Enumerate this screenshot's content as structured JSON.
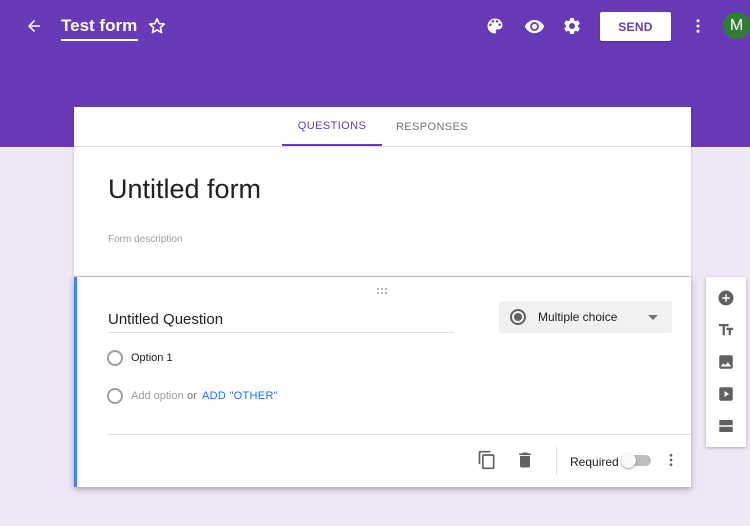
{
  "header": {
    "form_name": "Test form",
    "send_label": "SEND",
    "avatar_initial": "M"
  },
  "tabs": [
    {
      "label": "QUESTIONS",
      "active": true
    },
    {
      "label": "RESPONSES",
      "active": false
    }
  ],
  "form": {
    "title": "Untitled form",
    "description_placeholder": "Form description"
  },
  "question": {
    "title": "Untitled Question",
    "type": "Multiple choice",
    "options": [
      "Option 1"
    ],
    "add_option": "Add option",
    "or_text": "or",
    "add_other": "ADD \"OTHER\"",
    "required_label": "Required",
    "required": false
  },
  "colors": {
    "primary": "#673ab7",
    "accent_blue": "#4285f4",
    "background": "#ede7f6"
  },
  "icons": {
    "topbar": [
      "back-arrow-icon",
      "star-icon",
      "palette-icon",
      "eye-icon",
      "gear-icon",
      "more-vert-icon"
    ],
    "sidebar": [
      "add-circle-icon",
      "text-title-icon",
      "image-icon",
      "video-icon",
      "section-icon"
    ],
    "footer": [
      "duplicate-icon",
      "trash-icon",
      "more-vert-icon"
    ]
  }
}
